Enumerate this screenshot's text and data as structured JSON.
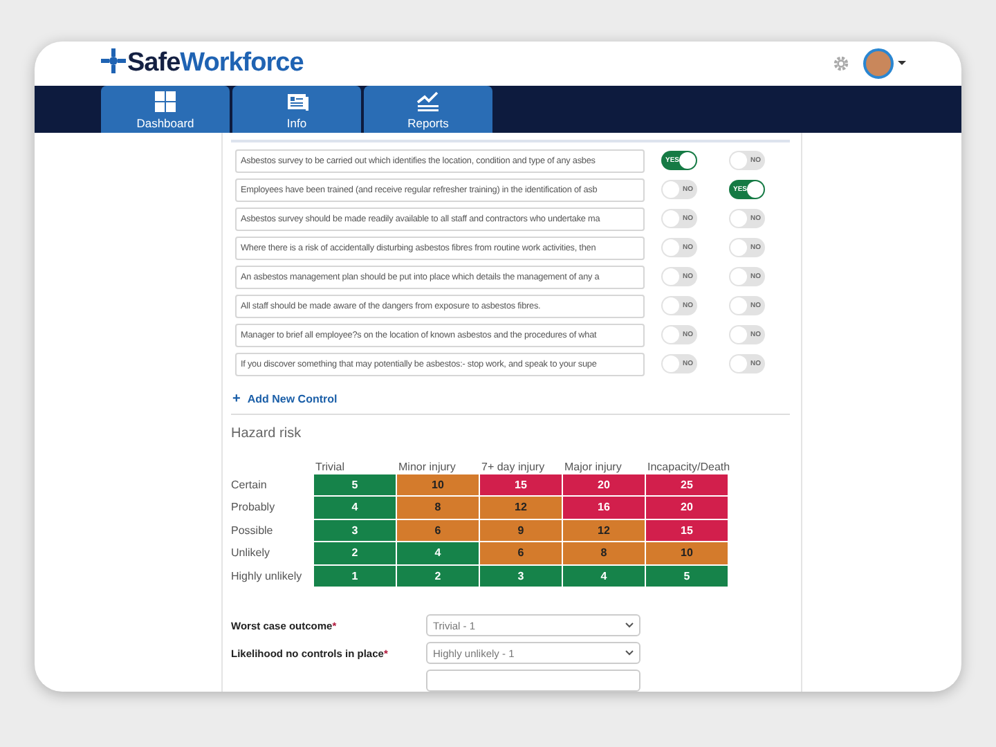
{
  "brand": {
    "first": "Safe",
    "second": "Workforce"
  },
  "tabs": [
    {
      "label": "Dashboard"
    },
    {
      "label": "Info"
    },
    {
      "label": "Reports"
    }
  ],
  "controls": [
    {
      "text": "Asbestos survey to be carried out which identifies the location, condition and type of any asbes",
      "toggles": [
        {
          "on": true,
          "label": "YES"
        },
        {
          "on": false,
          "label": "NO"
        }
      ]
    },
    {
      "text": "Employees have been trained (and receive regular refresher training) in the identification of asb",
      "toggles": [
        {
          "on": false,
          "label": "NO"
        },
        {
          "on": true,
          "label": "YES"
        }
      ]
    },
    {
      "text": "Asbestos survey should be made readily available to all staff and contractors who undertake ma",
      "toggles": [
        {
          "on": false,
          "label": "NO"
        },
        {
          "on": false,
          "label": "NO"
        }
      ]
    },
    {
      "text": "Where there is a risk of accidentally disturbing asbestos fibres from routine work activities, then",
      "toggles": [
        {
          "on": false,
          "label": "NO"
        },
        {
          "on": false,
          "label": "NO"
        }
      ]
    },
    {
      "text": "An asbestos management plan should be put into place which details the management of any a",
      "toggles": [
        {
          "on": false,
          "label": "NO"
        },
        {
          "on": false,
          "label": "NO"
        }
      ]
    },
    {
      "text": "All staff should be made aware of the dangers from exposure to asbestos fibres.",
      "toggles": [
        {
          "on": false,
          "label": "NO"
        },
        {
          "on": false,
          "label": "NO"
        }
      ]
    },
    {
      "text": "Manager to brief all employee?s on the location of known asbestos and the procedures of what",
      "toggles": [
        {
          "on": false,
          "label": "NO"
        },
        {
          "on": false,
          "label": "NO"
        }
      ]
    },
    {
      "text": "If you discover something that may potentially be asbestos:- stop work, and speak to your supe",
      "toggles": [
        {
          "on": false,
          "label": "NO"
        },
        {
          "on": false,
          "label": "NO"
        }
      ]
    }
  ],
  "add_control": {
    "icon": "+",
    "label": "Add New Control"
  },
  "hazard_risk": {
    "title": "Hazard risk",
    "columns": [
      "Trivial",
      "Minor injury",
      "7+ day injury",
      "Major injury",
      "Incapacity/Death"
    ],
    "rows": [
      {
        "label": "Certain",
        "cells": [
          {
            "value": "5",
            "kind": "low"
          },
          {
            "value": "10",
            "kind": "medium"
          },
          {
            "value": "15",
            "kind": "high"
          },
          {
            "value": "20",
            "kind": "high"
          },
          {
            "value": "25",
            "kind": "high"
          }
        ]
      },
      {
        "label": "Probably",
        "cells": [
          {
            "value": "4",
            "kind": "low"
          },
          {
            "value": "8",
            "kind": "medium"
          },
          {
            "value": "12",
            "kind": "medium"
          },
          {
            "value": "16",
            "kind": "high"
          },
          {
            "value": "20",
            "kind": "high"
          }
        ]
      },
      {
        "label": "Possible",
        "cells": [
          {
            "value": "3",
            "kind": "low"
          },
          {
            "value": "6",
            "kind": "medium"
          },
          {
            "value": "9",
            "kind": "medium"
          },
          {
            "value": "12",
            "kind": "medium"
          },
          {
            "value": "15",
            "kind": "high"
          }
        ]
      },
      {
        "label": "Unlikely",
        "cells": [
          {
            "value": "2",
            "kind": "low"
          },
          {
            "value": "4",
            "kind": "low"
          },
          {
            "value": "6",
            "kind": "medium"
          },
          {
            "value": "8",
            "kind": "medium"
          },
          {
            "value": "10",
            "kind": "medium"
          }
        ]
      },
      {
        "label": "Highly unlikely",
        "cells": [
          {
            "value": "1",
            "kind": "low"
          },
          {
            "value": "2",
            "kind": "low"
          },
          {
            "value": "3",
            "kind": "low"
          },
          {
            "value": "4",
            "kind": "low"
          },
          {
            "value": "5",
            "kind": "low"
          }
        ]
      }
    ]
  },
  "fields": [
    {
      "label": "Worst case outcome",
      "required_mark": "*",
      "value": "Trivial - 1"
    },
    {
      "label": "Likelihood no controls in place",
      "required_mark": "*",
      "value": "Highly unlikely - 1"
    }
  ]
}
